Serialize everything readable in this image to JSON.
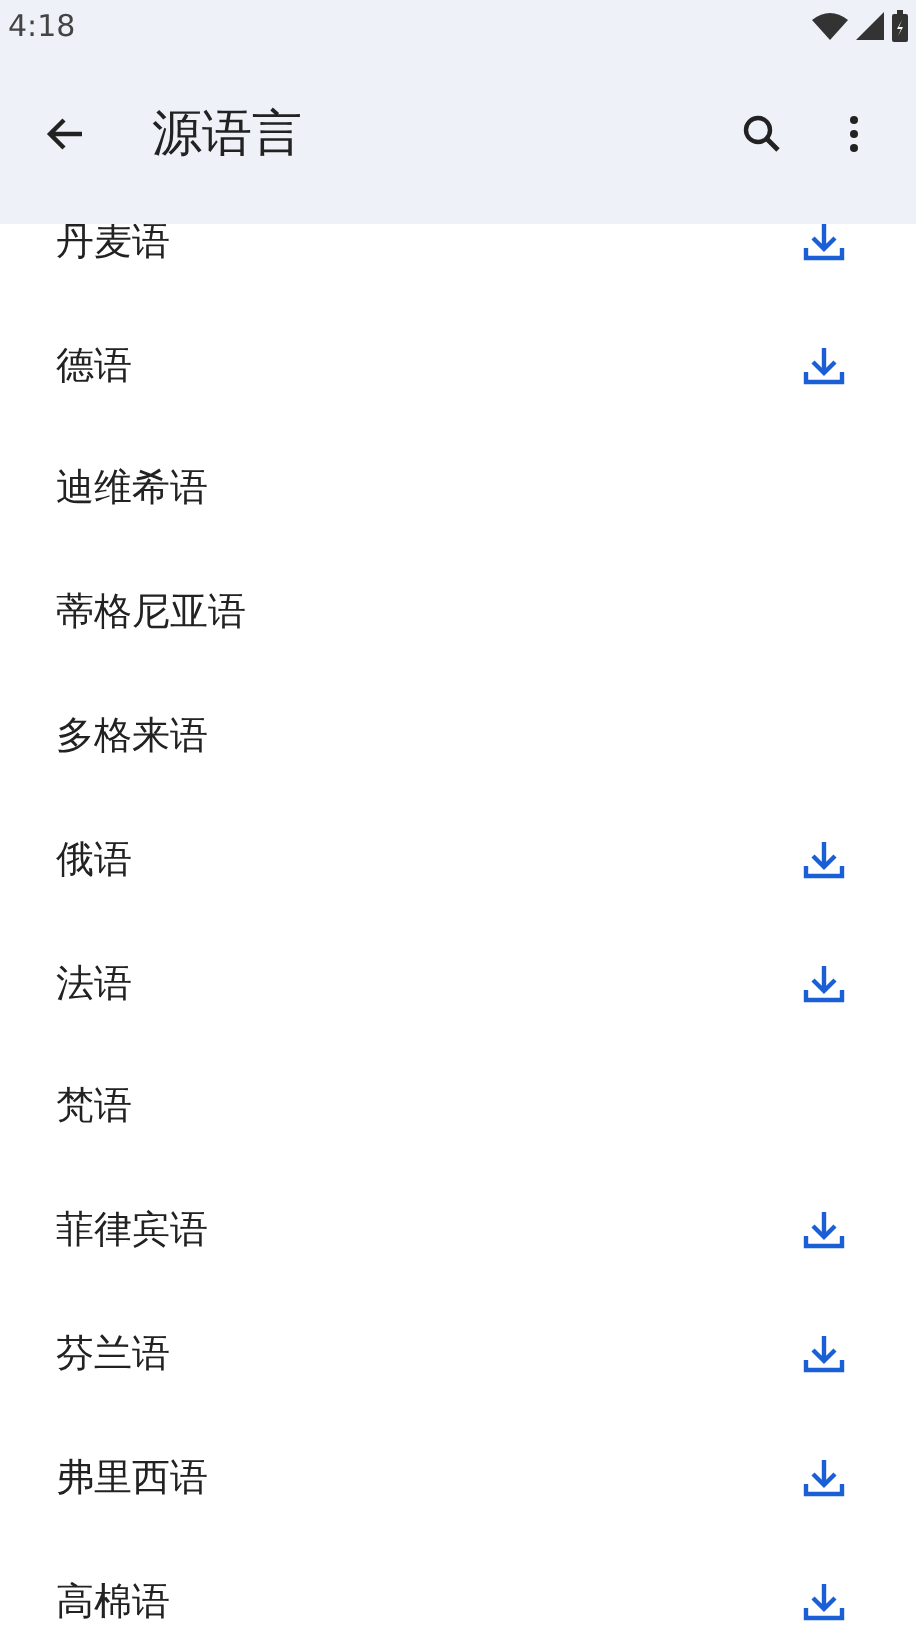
{
  "status_bar": {
    "time": "4:18"
  },
  "app_bar": {
    "title": "源语言"
  },
  "languages": [
    {
      "name": "丹麦语",
      "downloadable": true
    },
    {
      "name": "德语",
      "downloadable": true
    },
    {
      "name": "迪维希语",
      "downloadable": false
    },
    {
      "name": "蒂格尼亚语",
      "downloadable": false
    },
    {
      "name": "多格来语",
      "downloadable": false
    },
    {
      "name": "俄语",
      "downloadable": true
    },
    {
      "name": "法语",
      "downloadable": true
    },
    {
      "name": "梵语",
      "downloadable": false
    },
    {
      "name": "菲律宾语",
      "downloadable": true
    },
    {
      "name": "芬兰语",
      "downloadable": true
    },
    {
      "name": "弗里西语",
      "downloadable": true
    },
    {
      "name": "高棉语",
      "downloadable": true
    }
  ]
}
